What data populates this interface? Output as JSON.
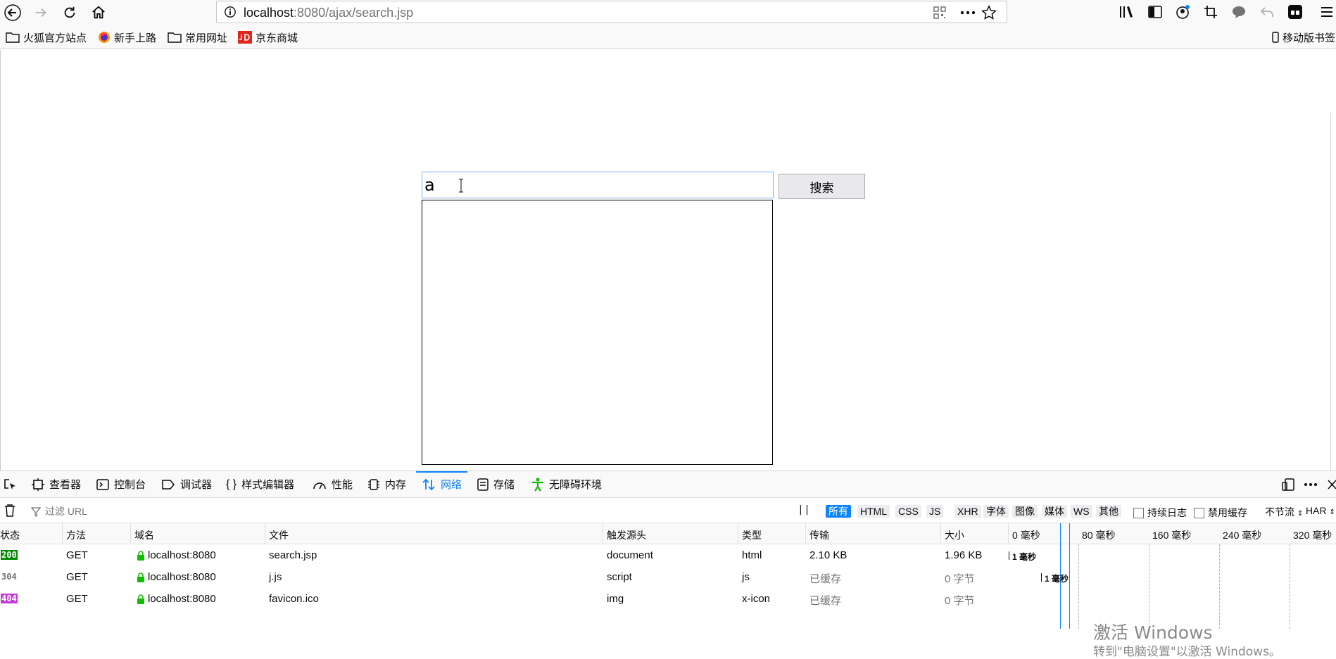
{
  "browser": {
    "url_host": "localhost",
    "url_rest": ":8080/ajax/search.jsp"
  },
  "bookmarks": [
    {
      "label": "火狐官方站点",
      "icon": "folder-icon"
    },
    {
      "label": "新手上路",
      "icon": "firefox-icon"
    },
    {
      "label": "常用网址",
      "icon": "folder-icon"
    },
    {
      "label": "京东商城",
      "icon": "jd-logo-icon"
    }
  ],
  "bookmarks_mobile": "移动版书签",
  "page": {
    "search_value": "a",
    "search_button": "搜索"
  },
  "devtools": {
    "tabs": [
      "查看器",
      "控制台",
      "调试器",
      "样式编辑器",
      "性能",
      "内存",
      "网络",
      "存储",
      "无障碍环境"
    ],
    "active_tab": "网络",
    "filter_placeholder": "过滤 URL",
    "pause": "| |",
    "type_filters": [
      "所有",
      "HTML",
      "CSS",
      "JS",
      "XHR",
      "字体",
      "图像",
      "媒体",
      "WS",
      "其他"
    ],
    "persist_log": "持续日志",
    "disable_cache": "禁用缓存",
    "throttle": "不节流",
    "har": "HAR",
    "columns": [
      "状态",
      "方法",
      "域名",
      "文件",
      "触发源头",
      "类型",
      "传输",
      "大小"
    ],
    "timeline_ticks": [
      "0 毫秒",
      "80 毫秒",
      "160 毫秒",
      "240 毫秒",
      "320 毫秒"
    ],
    "requests": [
      {
        "status": "200",
        "status_color": "#058b00",
        "method": "GET",
        "domain": "localhost:8080",
        "file": "search.jsp",
        "cause": "document",
        "type": "html",
        "transferred": "2.10 KB",
        "size": "1.96 KB",
        "timing": "1 毫秒"
      },
      {
        "status": "304",
        "status_color": "#ffffff",
        "method": "GET",
        "domain": "localhost:8080",
        "file": "j.js",
        "cause": "script",
        "type": "js",
        "transferred": "已缓存",
        "size": "0 字节",
        "timing": "1 毫秒"
      },
      {
        "status": "404",
        "status_color": "#c63ad6",
        "method": "GET",
        "domain": "localhost:8080",
        "file": "favicon.ico",
        "cause": "img",
        "type": "x-icon",
        "transferred": "已缓存",
        "size": "0 字节",
        "timing": ""
      }
    ]
  },
  "watermark": {
    "line1": "激活 Windows",
    "line2": "转到\"电脑设置\"以激活 Windows。"
  }
}
